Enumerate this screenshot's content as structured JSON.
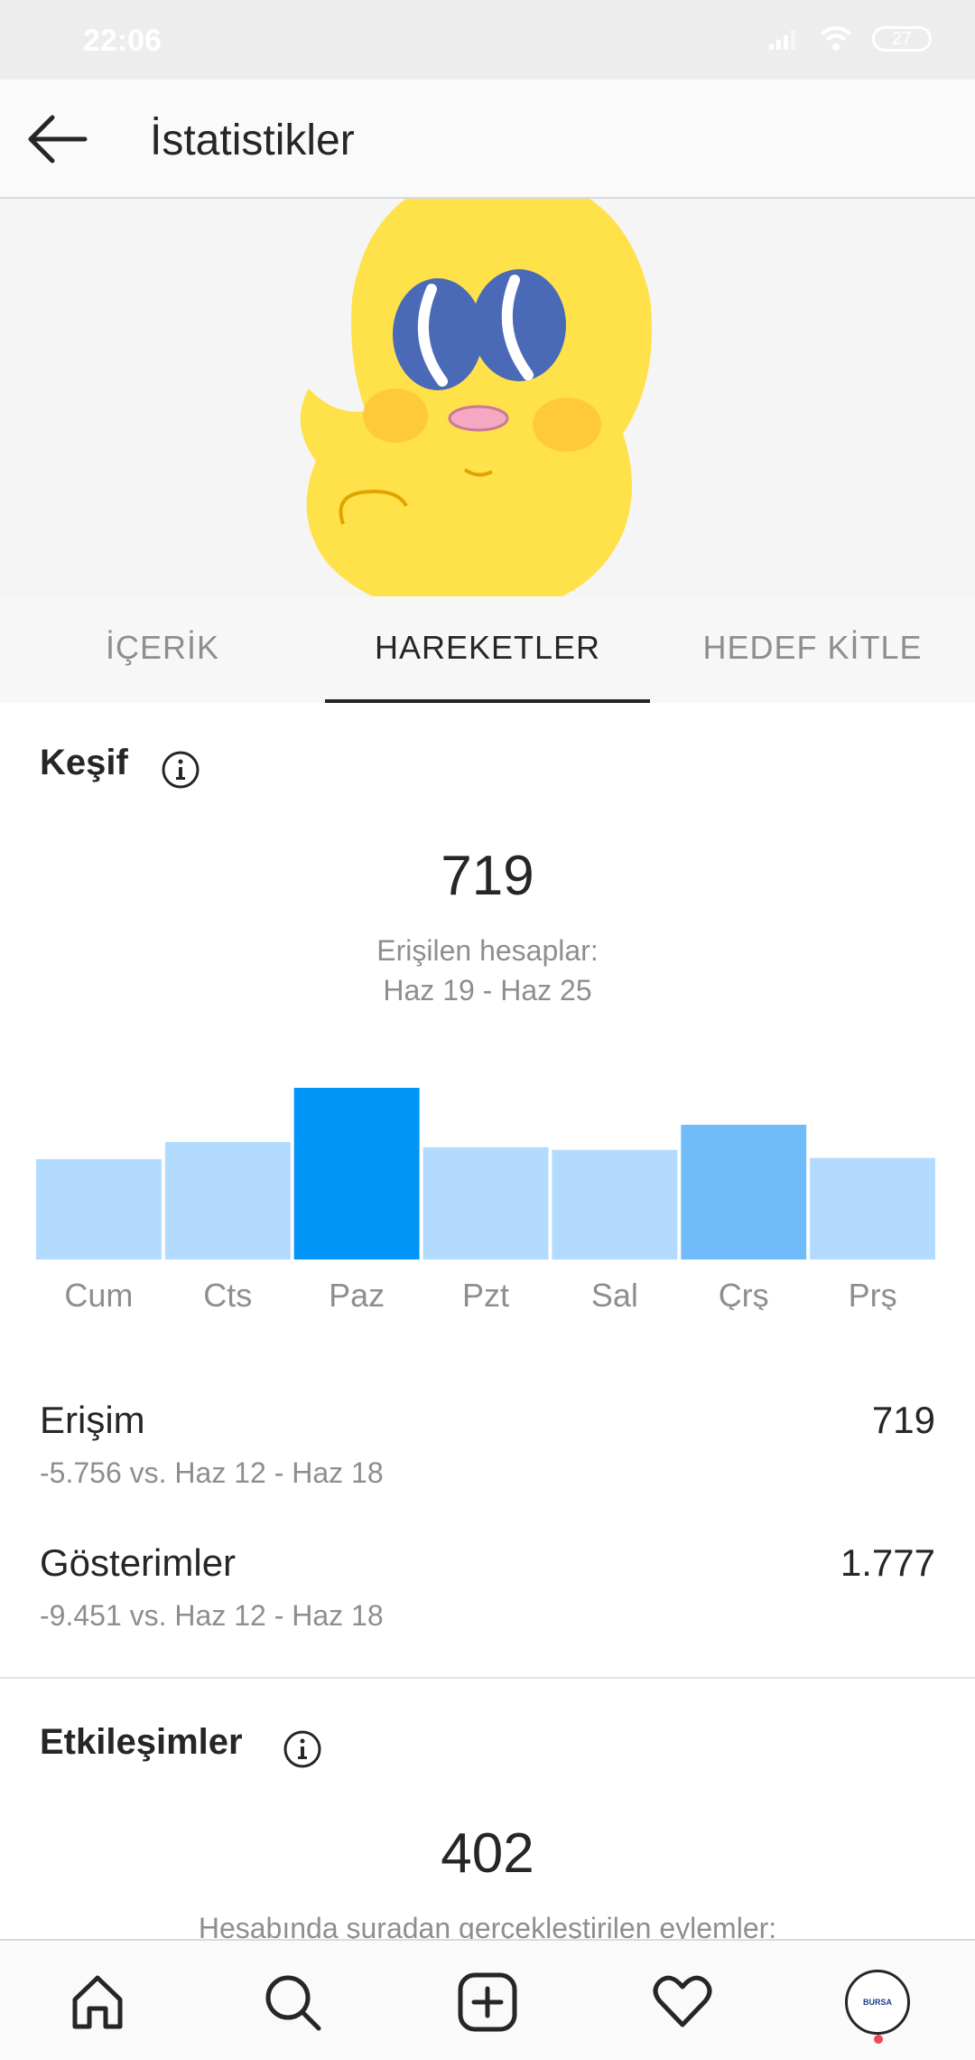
{
  "status_bar": {
    "time": "22:06",
    "battery": "27"
  },
  "header": {
    "title": "İstatistikler"
  },
  "tabs": [
    {
      "label": "İÇERİK",
      "active": false
    },
    {
      "label": "HAREKETLER",
      "active": true
    },
    {
      "label": "HEDEF KİTLE",
      "active": false
    }
  ],
  "discovery": {
    "title": "Keşif",
    "total": "719",
    "caption_line1": "Erişilen hesaplar:",
    "caption_line2": "Haz 19 - Haz 25",
    "metrics": [
      {
        "label": "Erişim",
        "value": "719",
        "comparison": "-5.756 vs. Haz 12 - Haz 18"
      },
      {
        "label": "Gösterimler",
        "value": "1.777",
        "comparison": "-9.451 vs. Haz 12 - Haz 18"
      }
    ]
  },
  "interactions": {
    "title": "Etkileşimler",
    "total": "402",
    "caption_line1": "Hesabında şuradan gerçekleştirilen eylemler:"
  },
  "chart_data": {
    "type": "bar",
    "categories": [
      "Cum",
      "Cts",
      "Paz",
      "Pzt",
      "Sal",
      "Çrş",
      "Prş"
    ],
    "values": [
      76,
      89,
      130,
      85,
      83,
      102,
      77
    ],
    "ylim": [
      0,
      130
    ],
    "colors": [
      "#b3dbff",
      "#b3dbff",
      "#0095f6",
      "#b3dbff",
      "#b3dbff",
      "#70bcfa",
      "#b3dbff"
    ],
    "grid": false,
    "legend": "none"
  },
  "bottom_nav": {
    "items": [
      {
        "icon": "home-icon"
      },
      {
        "icon": "search-icon"
      },
      {
        "icon": "add-post-icon"
      },
      {
        "icon": "heart-icon"
      },
      {
        "icon": "profile-avatar",
        "avatar_text": "BURSA"
      }
    ]
  }
}
